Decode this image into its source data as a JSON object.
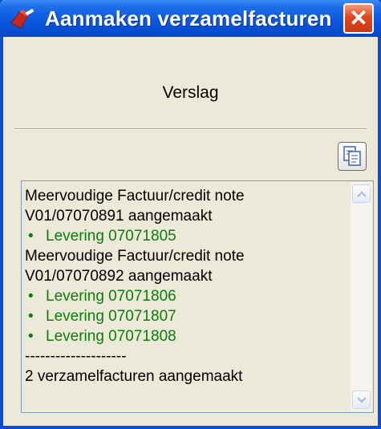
{
  "window": {
    "title": "Aanmaken verzamelfacturen",
    "close_glyph": "✕"
  },
  "heading": "Verslag",
  "log": {
    "lines": [
      {
        "text": "Meervoudige Factuur/credit note",
        "bullet": false,
        "color": "#000000"
      },
      {
        "text": "V01/07070891 aangemaakt",
        "bullet": false,
        "color": "#000000"
      },
      {
        "text": "Levering 07071805",
        "bullet": true,
        "color": "#0a7d0a"
      },
      {
        "text": "Meervoudige Factuur/credit note",
        "bullet": false,
        "color": "#000000"
      },
      {
        "text": "V01/07070892 aangemaakt",
        "bullet": false,
        "color": "#000000"
      },
      {
        "text": "Levering 07071806",
        "bullet": true,
        "color": "#0a7d0a"
      },
      {
        "text": "Levering 07071807",
        "bullet": true,
        "color": "#0a7d0a"
      },
      {
        "text": "Levering 07071808",
        "bullet": true,
        "color": "#0a7d0a"
      },
      {
        "text": "--------------------",
        "bullet": false,
        "color": "#000000"
      },
      {
        "text": "2 verzamelfacturen aangemaakt",
        "bullet": false,
        "color": "#000000"
      }
    ],
    "bullet_glyph": "•"
  },
  "icons": {
    "app": "app-icon",
    "close": "close-icon",
    "copy": "copy-icon",
    "scroll_up": "scroll-up-arrow-icon",
    "scroll_down": "scroll-down-arrow-icon"
  },
  "colors": {
    "titlebar": "#0a58e0",
    "window_bg": "#ece9d8",
    "log_green": "#0a7d0a",
    "close_red": "#e0461f"
  }
}
